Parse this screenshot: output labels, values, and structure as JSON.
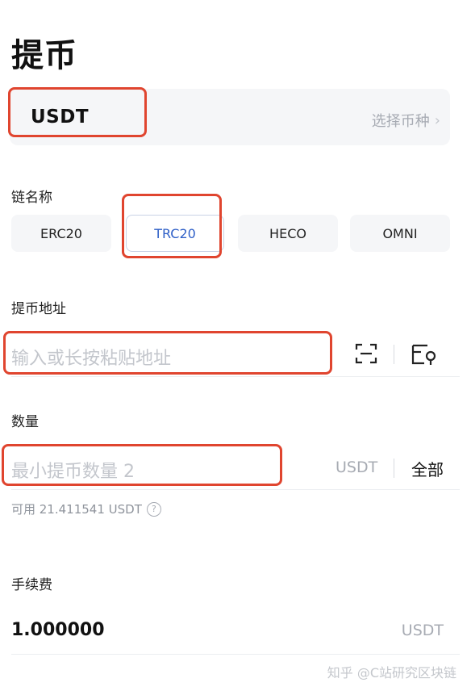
{
  "page": {
    "title": "提币"
  },
  "coin": {
    "name": "USDT",
    "select_label": "选择币种"
  },
  "chain": {
    "label": "链名称",
    "options": [
      "ERC20",
      "TRC20",
      "HECO",
      "OMNI"
    ],
    "selected": "TRC20"
  },
  "address": {
    "label": "提币地址",
    "placeholder": "输入或长按粘贴地址"
  },
  "amount": {
    "label": "数量",
    "placeholder": "最小提币数量 2",
    "unit": "USDT",
    "all_label": "全部",
    "available": "可用 21.411541 USDT"
  },
  "fee": {
    "label": "手续费",
    "value": "1.000000",
    "unit": "USDT"
  },
  "watermark": "知乎 @C站研究区块链",
  "colors": {
    "highlight": "#e0452f",
    "selected_text": "#2e5fc7",
    "box_bg": "#f5f6f8",
    "placeholder": "#c3c6cc"
  }
}
